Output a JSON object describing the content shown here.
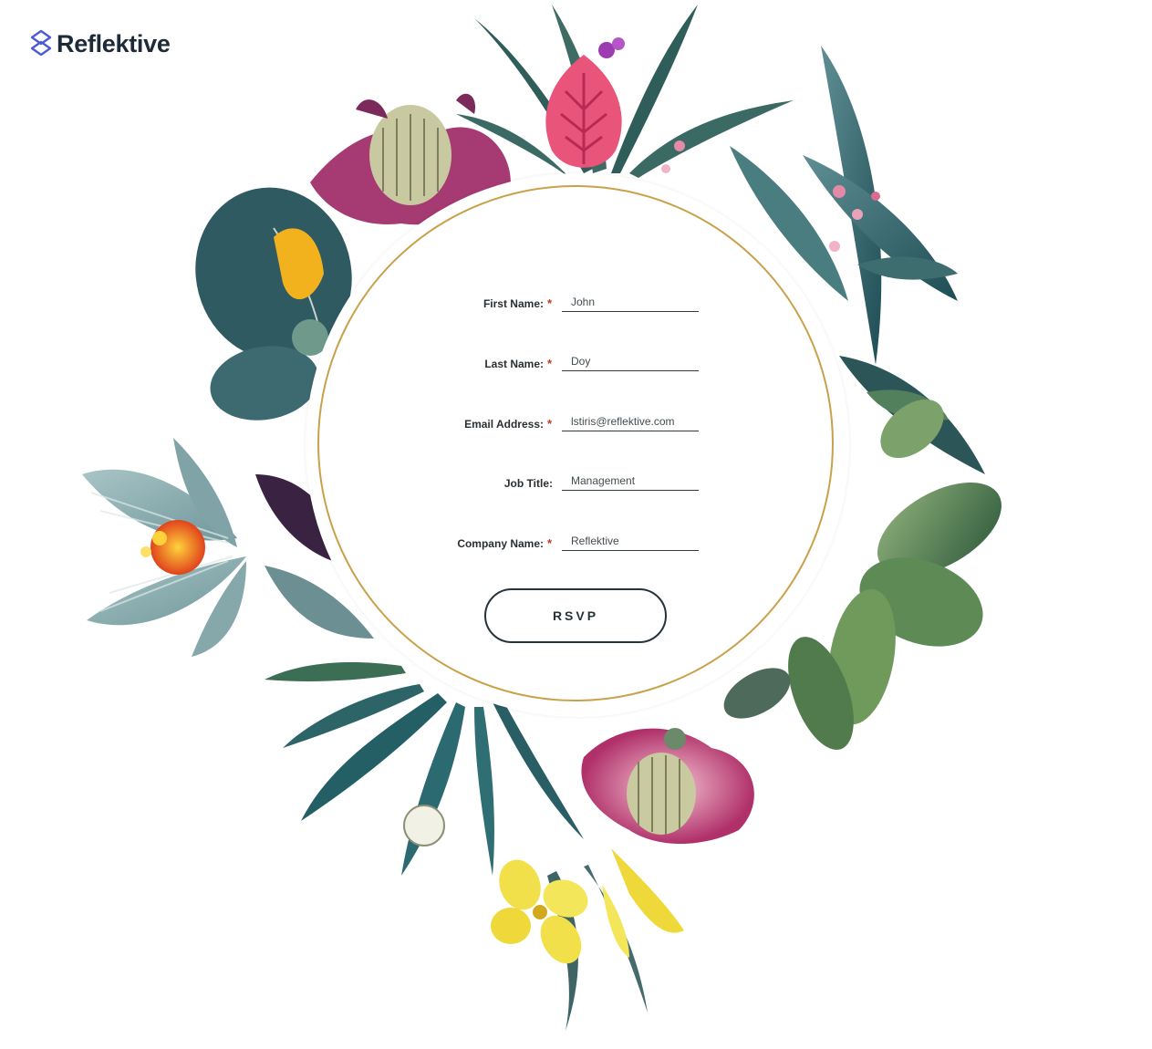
{
  "brand": {
    "name": "Reflektive",
    "accent_color": "#4b5bd6",
    "icon": "layers-logo-icon"
  },
  "form": {
    "fields": [
      {
        "label": "First Name:",
        "required": true,
        "value": "John"
      },
      {
        "label": "Last Name:",
        "required": true,
        "value": "Doy"
      },
      {
        "label": "Email Address:",
        "required": true,
        "value": "lstiris@reflektive.com"
      },
      {
        "label": "Job Title:",
        "required": false,
        "value": "Management"
      },
      {
        "label": "Company Name:",
        "required": true,
        "value": "Reflektive"
      }
    ],
    "required_marker": "*",
    "submit_label": "RSVP"
  },
  "colors": {
    "ring": "#c9a14a",
    "required": "#c0392b",
    "text": "#2a2f33",
    "button_border": "#25343a"
  },
  "decoration": "botanical-wreath"
}
